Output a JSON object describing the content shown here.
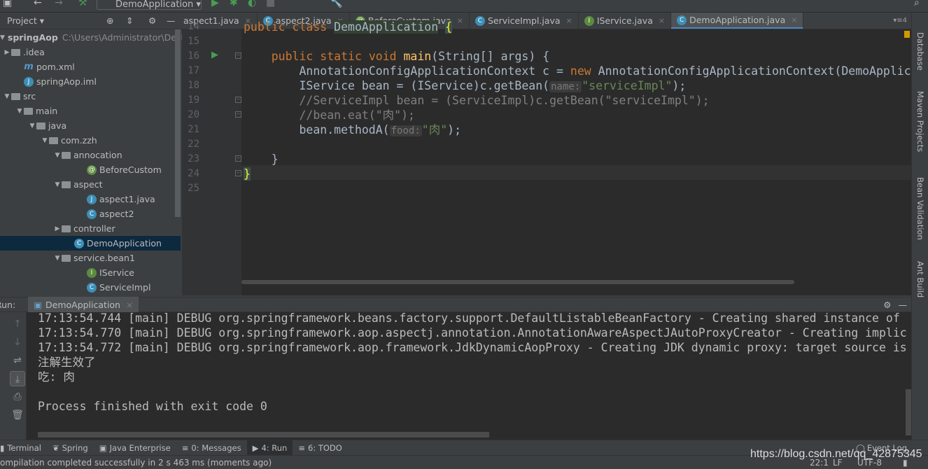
{
  "toolbar": {
    "run_config": "DemoApplication"
  },
  "project": {
    "title": "Project",
    "tree": [
      {
        "label": "springAop",
        "path": "C:\\Users\\Administrator\\Desk",
        "icon": "folder",
        "arrow": "down",
        "indent": 0,
        "bold": true
      },
      {
        "label": ".idea",
        "icon": "folder",
        "arrow": "right",
        "indent": 0
      },
      {
        "label": "pom.xml",
        "icon": "maven",
        "indent": 1
      },
      {
        "label": "springAop.iml",
        "icon": "file",
        "indent": 1
      },
      {
        "label": "src",
        "icon": "folder",
        "arrow": "down",
        "indent": 0
      },
      {
        "label": "main",
        "icon": "folder",
        "arrow": "down",
        "indent": 1
      },
      {
        "label": "java",
        "icon": "folder",
        "arrow": "down",
        "indent": 2
      },
      {
        "label": "com.zzh",
        "icon": "folder",
        "arrow": "down",
        "indent": 3
      },
      {
        "label": "annocation",
        "icon": "folder",
        "arrow": "down",
        "indent": 4
      },
      {
        "label": "BeforeCustom",
        "icon": "annotation",
        "indent": 6
      },
      {
        "label": "aspect",
        "icon": "folder",
        "arrow": "down",
        "indent": 4
      },
      {
        "label": "aspect1.java",
        "icon": "file",
        "indent": 6
      },
      {
        "label": "aspect2",
        "icon": "class",
        "indent": 6
      },
      {
        "label": "controller",
        "icon": "folder",
        "arrow": "right",
        "indent": 4
      },
      {
        "label": "DemoApplication",
        "icon": "class",
        "indent": 5,
        "selected": true
      },
      {
        "label": "service.bean1",
        "icon": "folder",
        "arrow": "down",
        "indent": 4
      },
      {
        "label": "IService",
        "icon": "interface",
        "indent": 6
      },
      {
        "label": "ServiceImpl",
        "icon": "class",
        "indent": 6
      }
    ]
  },
  "tabs": [
    {
      "label": "aspect1.java",
      "icon": "file"
    },
    {
      "label": "aspect2.java",
      "icon": "class"
    },
    {
      "label": "BeforeCustom.java",
      "icon": "annotation"
    },
    {
      "label": "ServiceImpl.java",
      "icon": "class"
    },
    {
      "label": "IService.java",
      "icon": "interface"
    },
    {
      "label": "DemoApplication.java",
      "icon": "class",
      "active": true
    }
  ],
  "tabs_more": "4",
  "editor": {
    "lines": [
      {
        "n": "14",
        "tokens": [
          [
            "public ",
            "kw"
          ],
          [
            "class ",
            "kw"
          ],
          [
            "DemoApplication",
            "hl"
          ],
          [
            " ",
            ""
          ],
          [
            "{",
            "brace"
          ]
        ]
      },
      {
        "n": "15",
        "tokens": []
      },
      {
        "n": "16",
        "tokens": [
          [
            "    public ",
            "kw"
          ],
          [
            "static ",
            "kw"
          ],
          [
            "void ",
            "kw"
          ],
          [
            "main",
            "fn"
          ],
          [
            "(String[] args) {",
            ""
          ]
        ]
      },
      {
        "n": "17",
        "tokens": [
          [
            "        AnnotationConfigApplicationContext c = ",
            ""
          ],
          [
            "new ",
            "kw"
          ],
          [
            "AnnotationConfigApplicationContext(DemoApplic",
            ""
          ]
        ]
      },
      {
        "n": "18",
        "tokens": [
          [
            "        IService bean = (IService)c.getBean(",
            ""
          ],
          [
            "name:",
            "hint"
          ],
          [
            "\"serviceImpl\"",
            "str"
          ],
          [
            ");",
            ""
          ]
        ]
      },
      {
        "n": "19",
        "tokens": [
          [
            "        //ServiceImpl bean = (ServiceImpl)c.getBean(\"serviceImpl\");",
            "cm"
          ]
        ]
      },
      {
        "n": "20",
        "tokens": [
          [
            "        //bean.eat(\"肉\");",
            "cm"
          ]
        ]
      },
      {
        "n": "21",
        "tokens": [
          [
            "        bean.methodA(",
            ""
          ],
          [
            "food:",
            "hint"
          ],
          [
            "\"肉\"",
            "str"
          ],
          [
            ");",
            ""
          ]
        ]
      },
      {
        "n": "22",
        "tokens": []
      },
      {
        "n": "23",
        "tokens": [
          [
            "    }",
            ""
          ]
        ]
      },
      {
        "n": "24",
        "tokens": [
          [
            "}",
            "brace"
          ]
        ]
      },
      {
        "n": "25",
        "tokens": []
      }
    ]
  },
  "right_tools": [
    "Database",
    "Maven Projects",
    "Bean Validation",
    "Ant Build"
  ],
  "run": {
    "label": "Run:",
    "tab": "DemoApplication",
    "console": [
      "17:13:54.744 [main] DEBUG org.springframework.beans.factory.support.DefaultListableBeanFactory - Creating shared instance of",
      "17:13:54.770 [main] DEBUG org.springframework.aop.aspectj.annotation.AnnotationAwareAspectJAutoProxyCreator - Creating implic",
      "17:13:54.772 [main] DEBUG org.springframework.aop.framework.JdkDynamicAopProxy - Creating JDK dynamic proxy: target source is",
      "注解生效了",
      "吃: 肉",
      "",
      "Process finished with exit code 0"
    ]
  },
  "bottom_tabs": [
    {
      "label": "Terminal"
    },
    {
      "label": "Spring"
    },
    {
      "label": "Java Enterprise"
    },
    {
      "label": "0: Messages"
    },
    {
      "label": "4: Run",
      "active": true
    },
    {
      "label": "6: TODO"
    }
  ],
  "event_log": "Event Log",
  "status": {
    "message": "ompilation completed successfully in 2 s 463 ms (moments ago)",
    "position": "22:1",
    "line_sep": "LF",
    "encoding": "UTF-8"
  },
  "watermark": "https://blog.csdn.net/qq_42875345"
}
